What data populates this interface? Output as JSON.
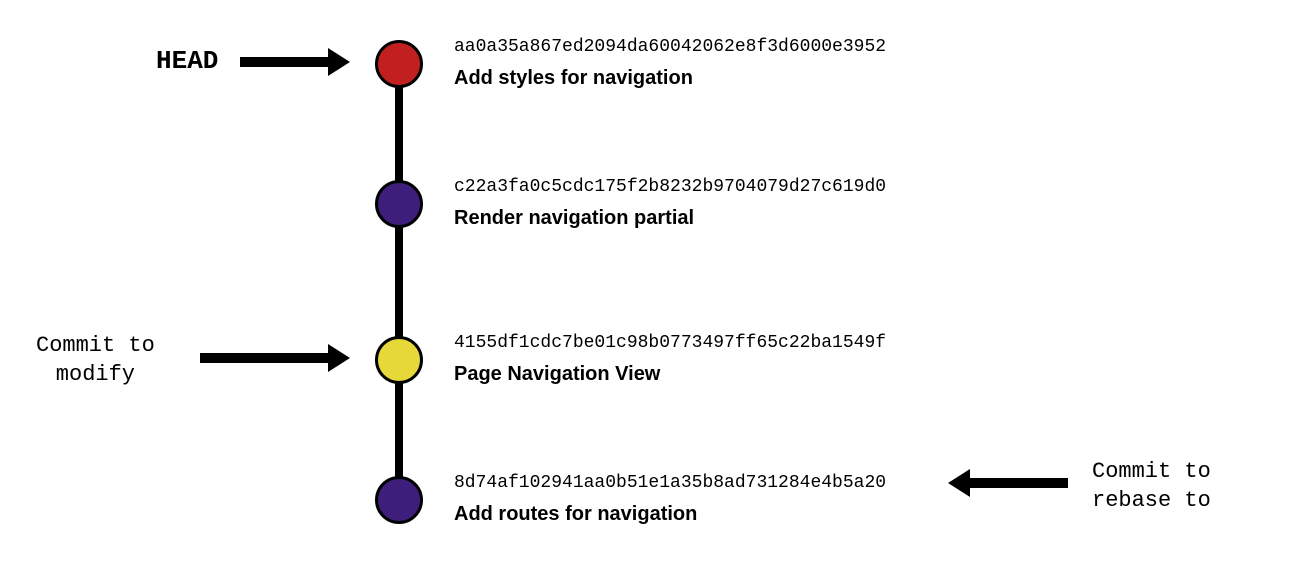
{
  "commits": [
    {
      "hash": "aa0a35a867ed2094da60042062e8f3d6000e3952",
      "message": "Add styles for navigation",
      "color": "red"
    },
    {
      "hash": "c22a3fa0c5cdc175f2b8232b9704079d27c619d0",
      "message": "Render navigation partial",
      "color": "purple"
    },
    {
      "hash": "4155df1cdc7be01c98b0773497ff65c22ba1549f",
      "message": "Page Navigation View",
      "color": "yellow"
    },
    {
      "hash": "8d74af102941aa0b51e1a35b8ad731284e4b5a20",
      "message": "Add routes for navigation",
      "color": "purple"
    }
  ],
  "labels": {
    "head": "HEAD",
    "modify_line1": "Commit to",
    "modify_line2": "modify",
    "rebase_line1": "Commit to",
    "rebase_line2": "rebase to"
  }
}
